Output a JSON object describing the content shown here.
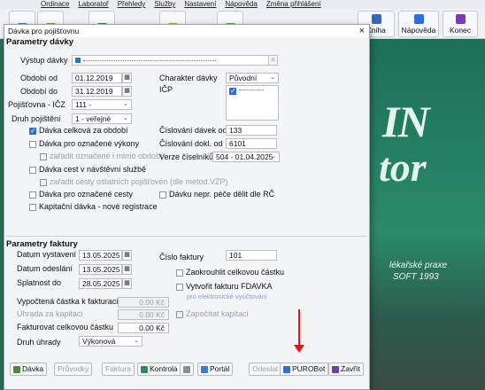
{
  "menu": [
    "Ordinace",
    "Laboratoř",
    "Přehledy",
    "Služby",
    "Nastavení",
    "Nápověda",
    "Změna přihlášení"
  ],
  "toolbar": {
    "kniha_label": "Kniha",
    "napoveda_label": "Nápověda",
    "konec_label": "Konec"
  },
  "background": {
    "line1": "IN",
    "line2": "tor",
    "tag1": "lékařské praxe",
    "tag2": "SOFT 1993"
  },
  "dialog": {
    "title": "Dávka pro pojišťovnu",
    "close": "×",
    "section1": "Parametry dávky",
    "section2": "Parametry faktury",
    "fields": {
      "vystup_label": "Výstup dávky",
      "obdobi_od_label": "Období od",
      "obdobi_od": "01.12.2019",
      "obdobi_do_label": "Období do",
      "obdobi_do": "31.12.2019",
      "pojistovna_label": "Pojišťovna - IČZ",
      "pojistovna": "111 -",
      "druh_pojisteni_label": "Druh pojištění",
      "druh_pojisteni": "1 - veřejné",
      "charakter_label": "Charakter dávky",
      "charakter": "Původní",
      "icp_label": "IČP",
      "cislovani_davek_label": "Číslování dávek od",
      "cislovani_davek": "133",
      "cislovani_dokl_label": "Číslování dokl. od",
      "cislovani_dokl": "6101",
      "verze_label": "Verze číselníků",
      "verze": "504 - 01.04.2025"
    },
    "checks": {
      "davka_celkova": "Dávka celková za období",
      "davka_oznacene_vykony": "Dávka pro označené výkony",
      "zaradit_oznacene": "zařadit označené i mimo období",
      "davka_cest": "Dávka cest v návštěvní službě",
      "zaradit_cesty": "zařadit cesty ostatních pojišťoven (dle metod.VZP)",
      "davka_oznacene_cesty": "Dávka pro označené cesty",
      "kapitacni": "Kapitační dávka - nové registrace",
      "davku_nepr": "Dávku nepr. péče dělit dle RČ"
    },
    "faktura": {
      "datum_vystaveni_label": "Datum vystavení",
      "datum_vystaveni": "13.05.2025",
      "datum_odeslani_label": "Datum odeslání",
      "datum_odeslani": "13.05.2025",
      "splatnost_label": "Splatnost do",
      "splatnost": "28.05.2025",
      "cislo_label": "Číslo faktury",
      "cislo": "101",
      "zaokrouhlit": "Zaokrouhlit celkovou částku",
      "vytvorit": "Vytvořit fakturu FDAVKA",
      "vytvorit_note": "pro elektronické vyúčtování",
      "zapocitat": "Započítat kapitaci",
      "vypoctena_label": "Vypočtená částka k fakturaci",
      "vypoctena": "0.00 Kč",
      "uhrada_label": "Úhrada za kapitaci",
      "uhrada": "0.00 Kč",
      "fakturovat_label": "Fakturovat celkovou částku",
      "fakturovat": "0.00 Kč",
      "druh_uhrady_label": "Druh úhrady",
      "druh_uhrady": "Výkonová"
    },
    "buttons": {
      "davka": "Dávka",
      "pruvodky": "Průvodky",
      "faktura": "Faktura",
      "kontrola": "Kontrola",
      "portal": "Portál",
      "odeslat": "Odeslat",
      "purobot": "PUROBot",
      "zavrit": "Zavřít"
    }
  },
  "colors": {
    "accent": "#2f6fd6",
    "arrow": "#e11111",
    "bg_green": "#2b6b52"
  }
}
